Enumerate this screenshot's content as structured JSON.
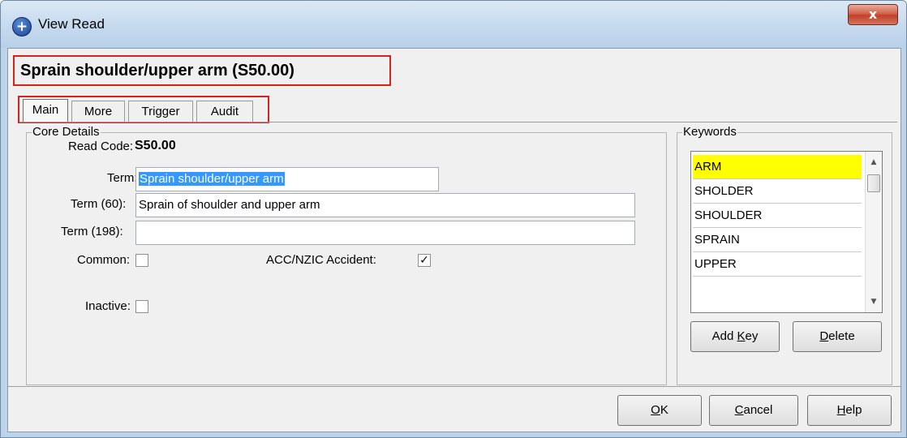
{
  "window": {
    "title": "View Read",
    "close_label": "x"
  },
  "header": {
    "title": "Sprain shoulder/upper arm (S50.00)"
  },
  "tabs": [
    {
      "label": "Main",
      "active": true
    },
    {
      "label": "More",
      "active": false
    },
    {
      "label": "Trigger",
      "active": false
    },
    {
      "label": "Audit",
      "active": false
    }
  ],
  "core": {
    "group_label": "Core Details",
    "read_code_label": "Read Code:",
    "read_code_value": "S50.00",
    "term_label": "Term:",
    "term_value": "Sprain shoulder/upper arm",
    "term60_label": "Term (60):",
    "term60_value": "Sprain of shoulder and upper arm",
    "term198_label": "Term (198):",
    "term198_value": "",
    "common_label": "Common:",
    "common_checked": false,
    "acc_label": "ACC/NZIC Accident:",
    "acc_checked": true,
    "inactive_label": "Inactive:",
    "inactive_checked": false
  },
  "keywords": {
    "group_label": "Keywords",
    "items": [
      "ARM",
      "SHOLDER",
      "SHOULDER",
      "SPRAIN",
      "UPPER"
    ],
    "highlight_color": "#ffff00",
    "add_key_prefix": "Add ",
    "add_key_underline": "K",
    "add_key_rest": "ey",
    "delete_underline": "D",
    "delete_rest": "elete"
  },
  "footer": {
    "ok_underline": "O",
    "ok_rest": "K",
    "cancel_underline": "C",
    "cancel_rest": "ancel",
    "help_underline": "H",
    "help_rest": "elp"
  },
  "colors": {
    "annotation_red": "#d9221b",
    "selection_blue": "#3399ff"
  }
}
